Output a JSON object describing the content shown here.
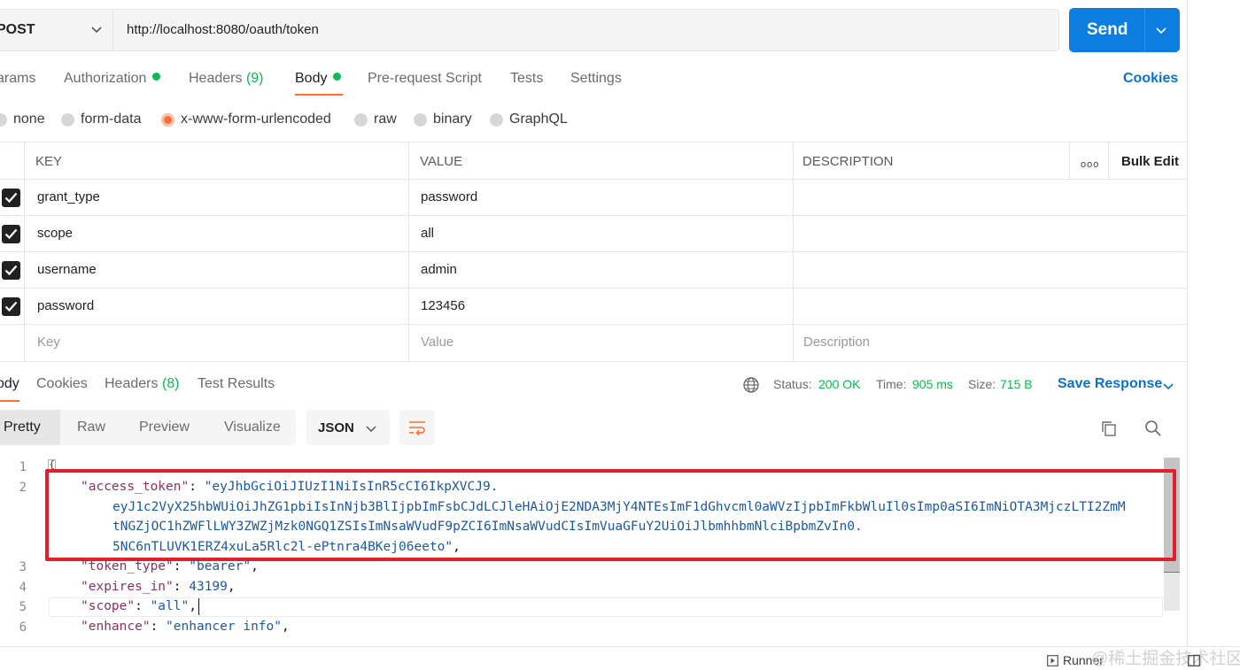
{
  "request": {
    "method": "POST",
    "url": "http://localhost:8080/oauth/token",
    "send_label": "Send"
  },
  "request_tabs": [
    {
      "label": "arams"
    },
    {
      "label": "Authorization"
    },
    {
      "label": "Headers",
      "count": "(9)"
    },
    {
      "label": "Body"
    },
    {
      "label": "Pre-request Script"
    },
    {
      "label": "Tests"
    },
    {
      "label": "Settings"
    }
  ],
  "cookies_label": "Cookies",
  "body_types": [
    "none",
    "form-data",
    "x-www-form-urlencoded",
    "raw",
    "binary",
    "GraphQL"
  ],
  "table": {
    "headers": {
      "key": "KEY",
      "value": "VALUE",
      "description": "DESCRIPTION"
    },
    "more_icon": "ooo",
    "bulk_edit": "Bulk Edit",
    "rows": [
      {
        "key": "grant_type",
        "value": "password",
        "checked": true
      },
      {
        "key": "scope",
        "value": "all",
        "checked": true
      },
      {
        "key": "username",
        "value": "admin",
        "checked": true
      },
      {
        "key": "password",
        "value": "123456",
        "checked": true
      }
    ],
    "placeholders": {
      "key": "Key",
      "value": "Value",
      "description": "Description"
    }
  },
  "response_tabs": [
    {
      "label": "ody"
    },
    {
      "label": "Cookies"
    },
    {
      "label": "Headers",
      "count": "(8)"
    },
    {
      "label": "Test Results"
    }
  ],
  "status": {
    "status_label": "Status:",
    "status_value": "200 OK",
    "time_label": "Time:",
    "time_value": "905 ms",
    "size_label": "Size:",
    "size_value": "715 B"
  },
  "save_response": "Save Response",
  "view_modes": [
    "Pretty",
    "Raw",
    "Preview",
    "Visualize"
  ],
  "format": "JSON",
  "code": {
    "line_numbers": [
      "1",
      "2",
      "3",
      "4",
      "5",
      "6"
    ],
    "access_token_key": "\"access_token\"",
    "access_token_part1": "\"eyJhbGciOiJIUzI1NiIsInR5cCI6IkpXVCJ9.",
    "access_token_part2": "eyJ1c2VyX25hbWUiOiJhZG1pbiIsInNjb3BlIjpbImFsbCJdLCJleHAiOjE2NDA3MjY4NTEsImF1dGhvcml0aWVzIjpbImFkbWluIl0sImp0aSI6ImNiOTA3MjczLTI2ZmM",
    "access_token_part3": "tNGZjOC1hZWFlLWY3ZWZjMzk0NGQ1ZSIsImNsaWVudF9pZCI6ImNsaWVudCIsImVuaGFuY2UiOiJlbmhhbmNlciBpbmZvIn0.",
    "access_token_part4": "5NC6nTLUVK1ERZ4xuLa5Rlc2l-ePtnra4BKej06eeto\"",
    "token_type_key": "\"token_type\"",
    "token_type_value": "\"bearer\"",
    "expires_in_key": "\"expires_in\"",
    "expires_in_value": "43199",
    "scope_key": "\"scope\"",
    "scope_value": "\"all\"",
    "enhance_key": "\"enhance\"",
    "enhance_value": "\"enhancer info\""
  },
  "footer": {
    "runner": "Runner",
    "watermark": "@稀土掘金技术社区"
  },
  "colors": {
    "send": "#0b7ee0",
    "accent": "#ff6c37",
    "success": "#0cbb52",
    "link": "#0b72c8",
    "highlight": "#e0202a"
  }
}
